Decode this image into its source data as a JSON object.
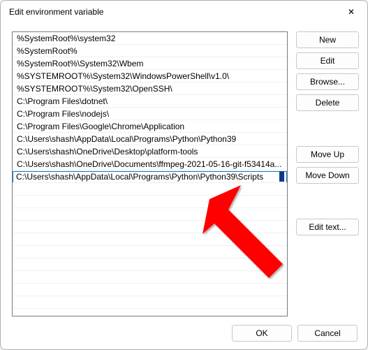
{
  "window": {
    "title": "Edit environment variable",
    "close_icon": "✕"
  },
  "list": {
    "items": [
      "%SystemRoot%\\system32",
      "%SystemRoot%",
      "%SystemRoot%\\System32\\Wbem",
      "%SYSTEMROOT%\\System32\\WindowsPowerShell\\v1.0\\",
      "%SYSTEMROOT%\\System32\\OpenSSH\\",
      "C:\\Program Files\\dotnet\\",
      "C:\\Program Files\\nodejs\\",
      "C:\\Program Files\\Google\\Chrome\\Application",
      "C:\\Users\\shash\\AppData\\Local\\Programs\\Python\\Python39",
      "C:\\Users\\shash\\OneDrive\\Desktop\\platform-tools",
      "C:\\Users\\shash\\OneDrive\\Documents\\ffmpeg-2021-05-16-git-f53414a..."
    ],
    "editing_value": "C:\\Users\\shash\\AppData\\Local\\Programs\\Python\\Python39\\Scripts",
    "selected_index": 11
  },
  "buttons": {
    "new": "New",
    "edit": "Edit",
    "browse": "Browse...",
    "delete": "Delete",
    "move_up": "Move Up",
    "move_down": "Move Down",
    "edit_text": "Edit text...",
    "ok": "OK",
    "cancel": "Cancel"
  },
  "annotation": {
    "arrow_color": "#ff0000"
  }
}
